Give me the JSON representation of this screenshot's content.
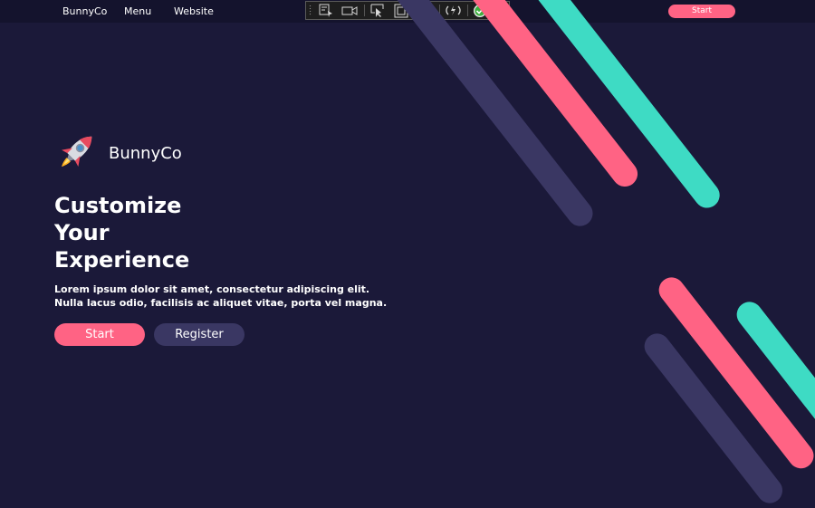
{
  "nav": {
    "brand": "BunnyCo",
    "links": [
      "Menu",
      "Website"
    ],
    "start_label": "Start"
  },
  "devtools_toolbar": {
    "icons": [
      "select-element-icon",
      "record-video-icon",
      "inspect-pointer-icon",
      "frame-selection-icon",
      "screen-pointer-icon",
      "hot-reload-icon",
      "check-status-icon",
      "collapse-chevron-icon"
    ]
  },
  "hero": {
    "brand_name": "BunnyCo",
    "title_lines": [
      "Customize",
      "Your",
      "Experience"
    ],
    "description_lines": [
      "Lorem ipsum dolor sit amet, consectetur adipiscing elit.",
      "Nulla lacus odio, facilisis ac aliquet vitae, porta vel magna."
    ],
    "start_label": "Start",
    "register_label": "Register",
    "logo_icon": "rocket-icon"
  },
  "colors": {
    "background": "#1b1939",
    "nav_background": "#14132d",
    "accent_pink": "#ff6384",
    "accent_teal": "#3edbc4",
    "accent_purple": "#3a3763"
  }
}
